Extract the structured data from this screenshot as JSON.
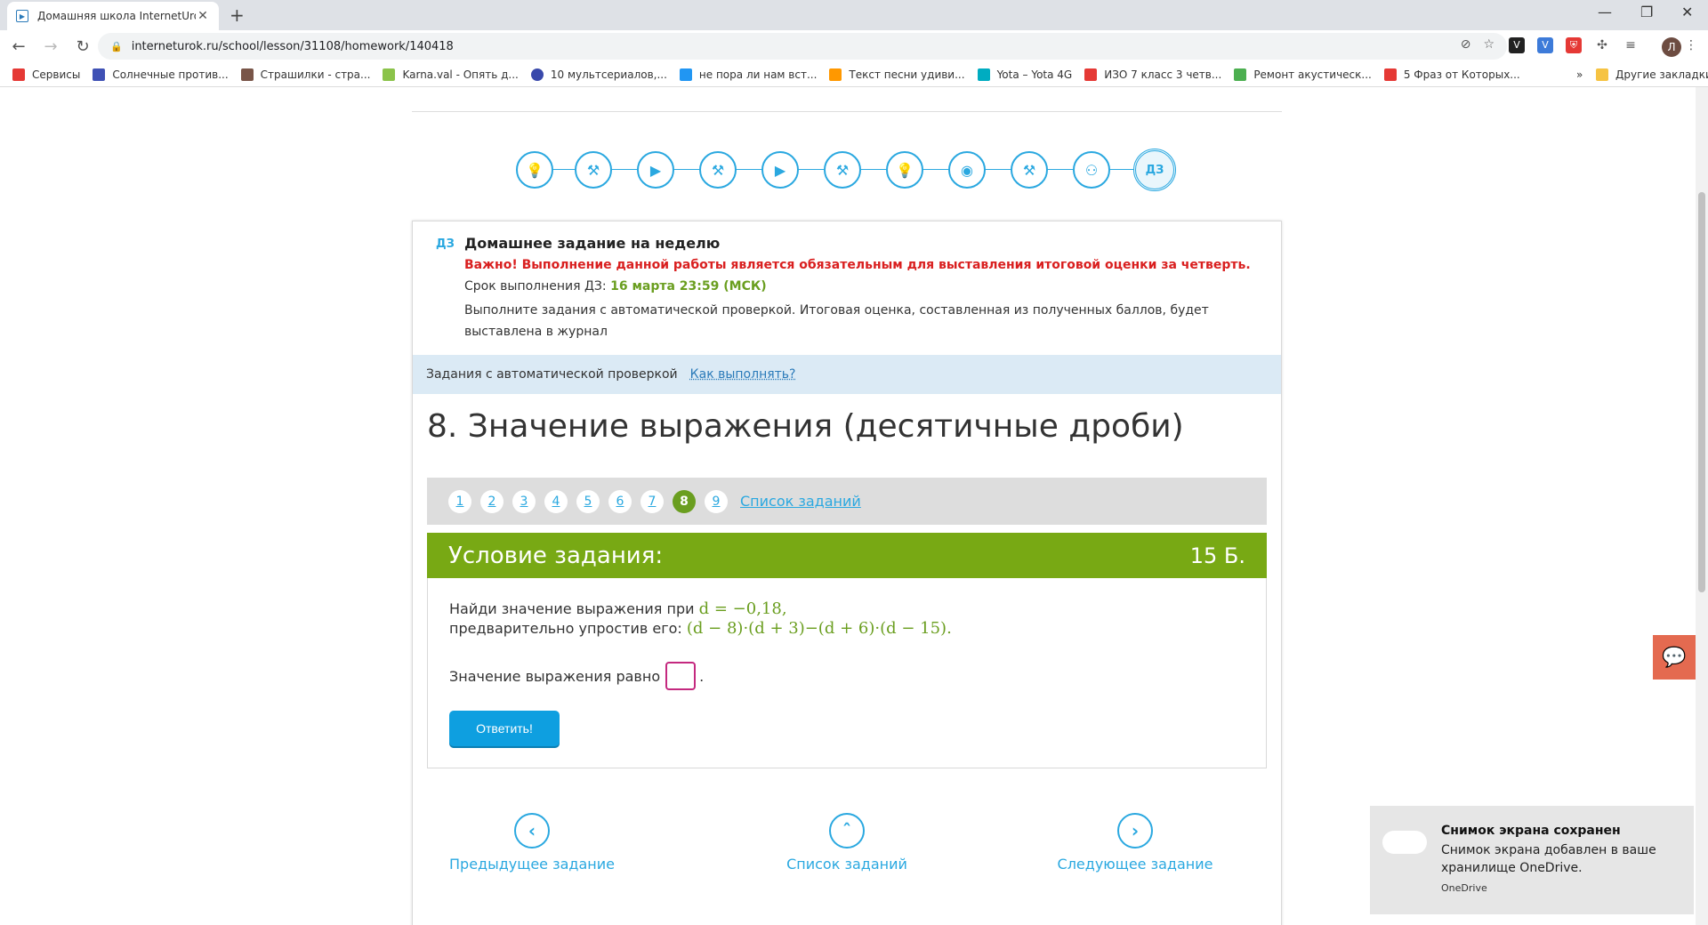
{
  "browser": {
    "tab_title": "Домашняя школа InternetUrok.r",
    "url": "interneturok.ru/school/lesson/31108/homework/140418",
    "bookmarks": [
      {
        "label": "Сервисы",
        "color": "#e53935"
      },
      {
        "label": "Солнечные против...",
        "color": "#3f51b5"
      },
      {
        "label": "Страшилки - стра...",
        "color": "#795548"
      },
      {
        "label": "Karna.val - Опять д...",
        "color": "#8bc34a"
      },
      {
        "label": "10 мультсериалов,...",
        "color": "#3949ab"
      },
      {
        "label": "не пора ли нам вст...",
        "color": "#2196f3"
      },
      {
        "label": "Текст песни удиви...",
        "color": "#ff9800"
      },
      {
        "label": "Yota – Yota 4G",
        "color": "#00acc1"
      },
      {
        "label": "ИЗО 7 класс 3 четв...",
        "color": "#e53935"
      },
      {
        "label": "Ремонт акустическ...",
        "color": "#4caf50"
      },
      {
        "label": "5 Фраз от Которых...",
        "color": "#e53935"
      }
    ],
    "other_bookmarks": "Другие закладки"
  },
  "steps": {
    "icons": [
      "lightbulb-icon",
      "dumbbell-icon",
      "play-icon",
      "dumbbell-icon",
      "play-icon",
      "dumbbell-icon",
      "lightbulb-icon",
      "webcam-icon",
      "dumbbell-icon",
      "bike-icon"
    ],
    "active_label": "ДЗ"
  },
  "homework": {
    "badge": "ДЗ",
    "title": "Домашнее задание на неделю",
    "warning": "Важно! Выполнение данной работы является обязательным для выставления итоговой оценки за четверть.",
    "deadline_label": "Срок выполнения ДЗ:",
    "deadline_value": "16 марта 23:59 (МСК)",
    "description": "Выполните задания с автоматической проверкой. Итоговая оценка, составленная из полученных баллов, будет выставлена в журнал"
  },
  "info_bar": {
    "label": "Задания с автоматической проверкой",
    "link": "Как выполнять?"
  },
  "task": {
    "title": "8. Значение выражения (десятичные дроби)",
    "pages": [
      "1",
      "2",
      "3",
      "4",
      "5",
      "6",
      "7",
      "8",
      "9"
    ],
    "active_page": "8",
    "list_link": "Список заданий",
    "condition_title": "Условие задания:",
    "points": "15 Б.",
    "question_line1": "Найди значение выражения при",
    "question_math1": "d = −0,18,",
    "question_line2": "предварительно упростив его:",
    "question_math2": "(d − 8)·(d + 3)−(d + 6)·(d − 15).",
    "answer_label": "Значение выражения равно",
    "answer_value": "",
    "answer_suffix": ".",
    "submit_label": "Ответить!"
  },
  "bottom_nav": {
    "prev": "Предыдущее задание",
    "list": "Список заданий",
    "next": "Следующее задание"
  },
  "toast": {
    "title": "Снимок экрана сохранен",
    "body": "Снимок экрана добавлен в ваше хранилище OneDrive.",
    "source": "OneDrive"
  },
  "colors": {
    "accent": "#2aa8e0",
    "green": "#78a914",
    "warning": "#d91f1f"
  }
}
